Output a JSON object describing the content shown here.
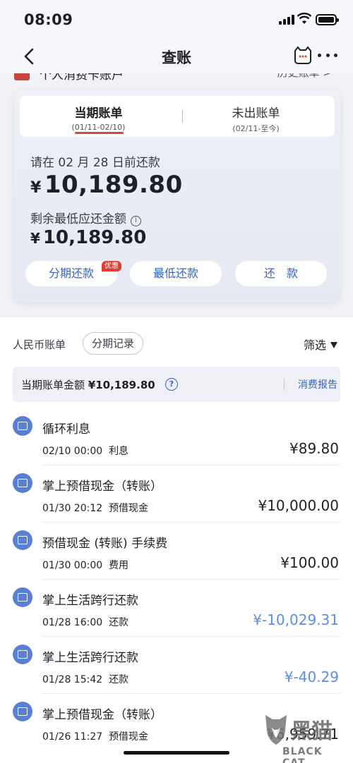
{
  "status": {
    "time": "08:09"
  },
  "nav": {
    "title": "查账"
  },
  "peek": {
    "left": "个人消费卡账户",
    "right": "历史账单 >"
  },
  "tabs": [
    {
      "label": "当期账单",
      "sub": "(01/11-02/10)"
    },
    {
      "label": "未出账单",
      "sub": "(02/11-至今)"
    }
  ],
  "due": {
    "label": "请在 02 月 28 日前还款",
    "currency": "¥",
    "amount": "10,189.80",
    "min_label": "剩余最低应还金额",
    "min_amount": "10,189.80"
  },
  "buttons": {
    "installment": "分期还款",
    "badge": "优惠",
    "min": "最低还款",
    "repay": "还　款"
  },
  "filter": {
    "rmb_bill": "人民币账单",
    "installment_record": "分期记录",
    "filter": "筛选"
  },
  "summary": {
    "label": "当期账单金额",
    "amount": "¥10,189.80",
    "report": "消费报告"
  },
  "transactions": [
    {
      "title": "循环利息",
      "datetime": "02/10 00:00",
      "type": "利息",
      "amount": "¥89.80",
      "icon": "percent-icon"
    },
    {
      "title": "掌上预借现金（转账）",
      "datetime": "01/30 20:12",
      "type": "预借现金",
      "amount": "¥10,000.00",
      "icon": "cash-advance-icon"
    },
    {
      "title": "预借现金 (转账) 手续费",
      "datetime": "01/30 00:00",
      "type": "费用",
      "amount": "¥100.00",
      "icon": "fee-icon"
    },
    {
      "title": "掌上生活跨行还款",
      "datetime": "01/28 16:00",
      "type": "还款",
      "amount": "¥-10,029.31",
      "icon": "card-icon"
    },
    {
      "title": "掌上生活跨行还款",
      "datetime": "01/28 15:42",
      "type": "还款",
      "amount": "¥-40.29",
      "icon": "card-icon"
    },
    {
      "title": "掌上预借现金（转账）",
      "datetime": "01/26 11:27",
      "type": "预借现金",
      "amount": "¥6,959.71",
      "icon": "cash-advance-icon"
    }
  ],
  "watermark": {
    "cn": "黑猫",
    "en": "BLACK CAT"
  }
}
